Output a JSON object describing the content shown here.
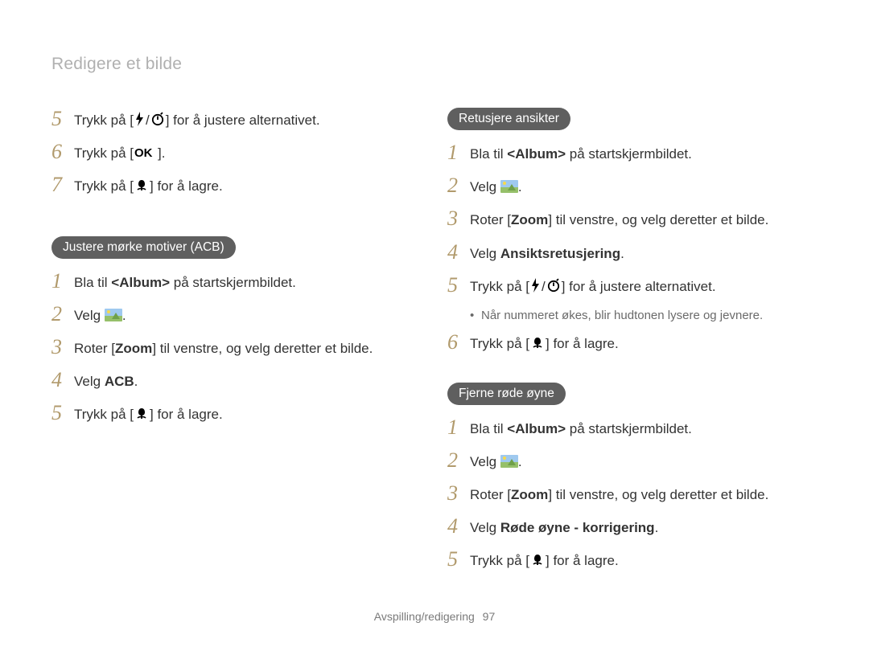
{
  "header": {
    "title": "Redigere et bilde"
  },
  "left": {
    "intro_steps": [
      {
        "num": "5",
        "segments": [
          {
            "t": "Trykk på ["
          },
          {
            "icon": "flash"
          },
          {
            "t": "/"
          },
          {
            "icon": "timer"
          },
          {
            "t": "] for å justere alternativet."
          }
        ]
      },
      {
        "num": "6",
        "segments": [
          {
            "t": "Trykk på ["
          },
          {
            "icon": "ok"
          },
          {
            "t": "]."
          }
        ]
      },
      {
        "num": "7",
        "segments": [
          {
            "t": "Trykk på ["
          },
          {
            "icon": "macro"
          },
          {
            "t": "] for å lagre."
          }
        ]
      }
    ],
    "section1": {
      "pill": "Justere mørke motiver (ACB)",
      "steps": [
        {
          "num": "1",
          "segments": [
            {
              "t": "Bla til "
            },
            {
              "bold": "<Album>"
            },
            {
              "t": " på startskjermbildet."
            }
          ]
        },
        {
          "num": "2",
          "segments": [
            {
              "t": "Velg "
            },
            {
              "icon": "landscape"
            },
            {
              "t": "."
            }
          ]
        },
        {
          "num": "3",
          "segments": [
            {
              "t": "Roter ["
            },
            {
              "bold": "Zoom"
            },
            {
              "t": "] til venstre, og velg deretter et bilde."
            }
          ]
        },
        {
          "num": "4",
          "segments": [
            {
              "t": "Velg "
            },
            {
              "bold": "ACB"
            },
            {
              "t": "."
            }
          ]
        },
        {
          "num": "5",
          "segments": [
            {
              "t": "Trykk på ["
            },
            {
              "icon": "macro"
            },
            {
              "t": "] for å lagre."
            }
          ]
        }
      ]
    }
  },
  "right": {
    "section1": {
      "pill": "Retusjere ansikter",
      "steps": [
        {
          "num": "1",
          "segments": [
            {
              "t": "Bla til "
            },
            {
              "bold": "<Album>"
            },
            {
              "t": " på startskjermbildet."
            }
          ]
        },
        {
          "num": "2",
          "segments": [
            {
              "t": "Velg "
            },
            {
              "icon": "landscape"
            },
            {
              "t": "."
            }
          ]
        },
        {
          "num": "3",
          "segments": [
            {
              "t": "Roter ["
            },
            {
              "bold": "Zoom"
            },
            {
              "t": "] til venstre, og velg deretter et bilde."
            }
          ]
        },
        {
          "num": "4",
          "segments": [
            {
              "t": "Velg "
            },
            {
              "bold": "Ansiktsretusjering"
            },
            {
              "t": "."
            }
          ]
        },
        {
          "num": "5",
          "segments": [
            {
              "t": "Trykk på ["
            },
            {
              "icon": "flash"
            },
            {
              "t": "/"
            },
            {
              "icon": "timer"
            },
            {
              "t": "] for å justere alternativet."
            }
          ]
        }
      ],
      "note": "Når nummeret økes, blir hudtonen lysere og jevnere.",
      "steps_after": [
        {
          "num": "6",
          "segments": [
            {
              "t": "Trykk på ["
            },
            {
              "icon": "macro"
            },
            {
              "t": "] for å lagre."
            }
          ]
        }
      ]
    },
    "section2": {
      "pill": "Fjerne røde øyne",
      "steps": [
        {
          "num": "1",
          "segments": [
            {
              "t": "Bla til "
            },
            {
              "bold": "<Album>"
            },
            {
              "t": " på startskjermbildet."
            }
          ]
        },
        {
          "num": "2",
          "segments": [
            {
              "t": "Velg "
            },
            {
              "icon": "landscape"
            },
            {
              "t": "."
            }
          ]
        },
        {
          "num": "3",
          "segments": [
            {
              "t": "Roter ["
            },
            {
              "bold": "Zoom"
            },
            {
              "t": "] til venstre, og velg deretter et bilde."
            }
          ]
        },
        {
          "num": "4",
          "segments": [
            {
              "t": "Velg "
            },
            {
              "bold": "Røde øyne - korrigering"
            },
            {
              "t": "."
            }
          ]
        },
        {
          "num": "5",
          "segments": [
            {
              "t": "Trykk på ["
            },
            {
              "icon": "macro"
            },
            {
              "t": "] for å lagre."
            }
          ]
        }
      ]
    }
  },
  "footer": {
    "section_label": "Avspilling/redigering",
    "page_number": "97"
  }
}
